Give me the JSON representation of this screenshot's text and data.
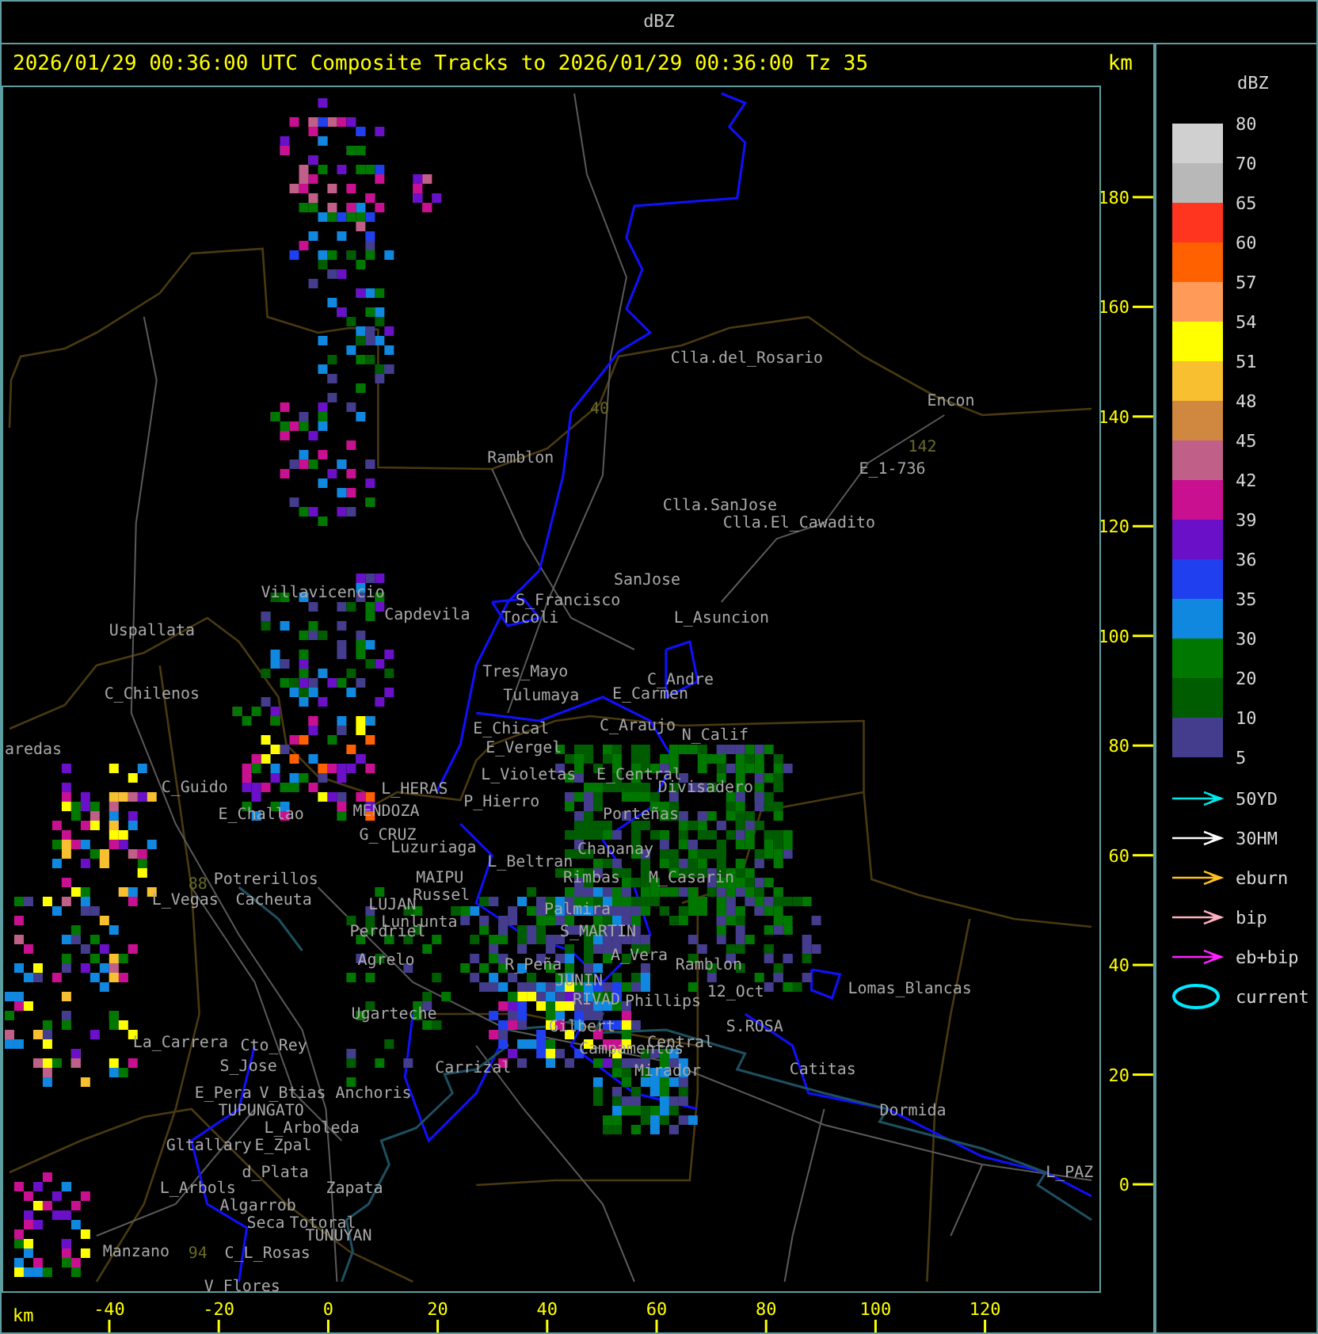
{
  "header": {
    "title": "dBZ"
  },
  "plot": {
    "title": "2026/01/29 00:36:00 UTC Composite Tracks to 2026/01/29 00:36:00 Tz 35",
    "unit_right": "km",
    "unit_bottom": "km",
    "y_ticks": [
      "180",
      "160",
      "140",
      "120",
      "100",
      "80",
      "60",
      "40",
      "20",
      "0"
    ],
    "x_ticks": [
      "-40",
      "-20",
      "0",
      "20",
      "40",
      "60",
      "80",
      "100",
      "120"
    ],
    "places": [
      "Clla.del_Rosario",
      "Encon",
      "Ramblon",
      "E_1-736",
      "Clla.SanJose",
      "Clla.El_Cawadito",
      "SanJose",
      "Villavicencio",
      "S_Francisco",
      "Capdevila",
      "Tocoli",
      "L_Asuncion",
      "Uspallata",
      "Tres_Mayo",
      "C_Andre",
      "C_Chilenos",
      "Tulumaya",
      "E_Carmen",
      "E_Chical",
      "C_Araujo",
      "N_Calif",
      "aredas",
      "E_Vergel",
      "L_Violetas",
      "E_Central",
      "C_Guido",
      "L_HERAS",
      "Divisadero",
      "P_Hierro",
      "E_Challao",
      "MENDOZA",
      "Porteñas",
      "G_CRUZ",
      "Luzuriaga",
      "Chapanay",
      "L_Beltran",
      "Potrerillos",
      "MAIPU",
      "Rimbas",
      "M_Casarin",
      "L_Vegas",
      "Cacheuta",
      "Russel",
      "LUJAN",
      "Palmira",
      "Lunlunta",
      "Perdriel",
      "S_MARTIN",
      "Agrelo",
      "R_Peña",
      "A_Vera",
      "Ramblon",
      "JUNIN",
      "RIVAD",
      "Phillips",
      "12_Oct",
      "Lomas_Blancas",
      "Ugarteche",
      "Gilbert",
      "S.ROSA",
      "La_Carrera",
      "Cto_Rey",
      "Campamentos",
      "Central",
      "S_Jose",
      "Carrizal",
      "Mirador",
      "Catitas",
      "E_Pera",
      "V_Btias",
      "Anchoris",
      "TUPUNGATO",
      "Dormida",
      "L_Arboleda",
      "Gltallary",
      "E_Zpal",
      "d_Plata",
      "L_PAZ",
      "L_Arbols",
      "Zapata",
      "Algarrob",
      "Seca",
      "Totoral",
      "TUNUYAN",
      "Manzano",
      "C_L_Rosas",
      "V_Flores"
    ],
    "route_numbers": [
      "40",
      "142",
      "88",
      "94"
    ]
  },
  "legend": {
    "title": "dBZ",
    "bins": [
      {
        "label": "80",
        "color": "#d0d0d0"
      },
      {
        "label": "70",
        "color": "#b8b8b8"
      },
      {
        "label": "65",
        "color": "#ff3520"
      },
      {
        "label": "60",
        "color": "#ff6000"
      },
      {
        "label": "57",
        "color": "#ff9a58"
      },
      {
        "label": "54",
        "color": "#ffff00"
      },
      {
        "label": "51",
        "color": "#f8c030"
      },
      {
        "label": "48",
        "color": "#d08840"
      },
      {
        "label": "45",
        "color": "#c06088"
      },
      {
        "label": "42",
        "color": "#c81090"
      },
      {
        "label": "39",
        "color": "#6a10c8"
      },
      {
        "label": "36",
        "color": "#2040f0"
      },
      {
        "label": "35",
        "color": "#1088e0"
      },
      {
        "label": "30",
        "color": "#007800"
      },
      {
        "label": "20",
        "color": "#005c00"
      },
      {
        "label": "10",
        "color": "#443c8c"
      }
    ],
    "bottom_label": "5",
    "tracks": [
      {
        "label": "50YD",
        "kind": "arrow",
        "color": "#00e8e8"
      },
      {
        "label": "30HM",
        "kind": "arrow",
        "color": "#ffffff"
      },
      {
        "label": "eburn",
        "kind": "arrow",
        "color": "#ffc020"
      },
      {
        "label": "bip",
        "kind": "arrow",
        "color": "#ffb0c0"
      },
      {
        "label": "eb+bip",
        "kind": "arrow",
        "color": "#ff20ff"
      },
      {
        "label": "current",
        "kind": "ellipse",
        "color": "#00e8ff"
      }
    ]
  }
}
